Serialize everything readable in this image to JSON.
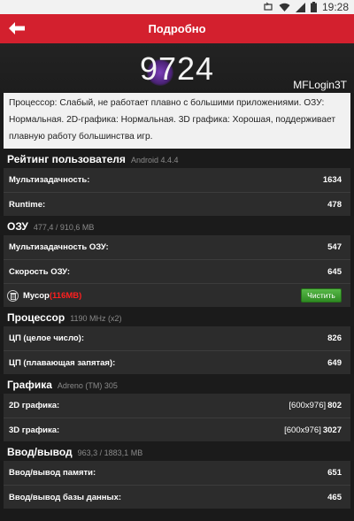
{
  "status": {
    "time": "19:28"
  },
  "appbar": {
    "title": "Подробно"
  },
  "result": {
    "score": "9724",
    "device": "MFLogin3T"
  },
  "description": "Процессор: Слабый, не работает плавно с большими приложениями. ОЗУ: Нормальная. 2D-графика: Нормальная. 3D графика: Хорошая, поддерживает плавную работу большинства игр.",
  "sections": {
    "ux": {
      "title": "Рейтинг пользователя",
      "info": "Android 4.4.4",
      "rows": [
        {
          "label": "Мультизадачность:",
          "value": "1634"
        },
        {
          "label": "Runtime:",
          "value": "478"
        }
      ]
    },
    "ram": {
      "title": "ОЗУ",
      "info": "477,4 / 910,6 MB",
      "rows": [
        {
          "label": "Мультизадачность ОЗУ:",
          "value": "547"
        },
        {
          "label": "Скорость ОЗУ:",
          "value": "645"
        }
      ],
      "cleaner": {
        "label": "Мусор",
        "used": "(116MB)",
        "button": "Чистить"
      }
    },
    "cpu": {
      "title": "Процессор",
      "info": "1190 MHz (x2)",
      "rows": [
        {
          "label": "ЦП (целое число):",
          "value": "826"
        },
        {
          "label": "ЦП (плавающая запятая):",
          "value": "649"
        }
      ]
    },
    "gpu": {
      "title": "Графика",
      "info": "Adreno (TM) 305",
      "rows": [
        {
          "label": "2D графика:",
          "resolution": "[600x976]",
          "value": "802"
        },
        {
          "label": "3D графика:",
          "resolution": "[600x976]",
          "value": "3027"
        }
      ]
    },
    "io": {
      "title": "Ввод/вывод",
      "info": "963,3 / 1883,1 MB",
      "rows": [
        {
          "label": "Ввод/вывод памяти:",
          "value": "651"
        },
        {
          "label": "Ввод/вывод базы данных:",
          "value": "465"
        }
      ]
    }
  },
  "icons": {
    "back": "back-arrow-icon",
    "trash": "trash-icon",
    "wifi": "wifi-icon",
    "signal": "signal-icon",
    "battery": "battery-icon",
    "orientation": "orientation-icon"
  },
  "colors": {
    "accent": "#d3202e",
    "clean_button": "#3f9e30",
    "used_memory": "#ff1f1f"
  }
}
